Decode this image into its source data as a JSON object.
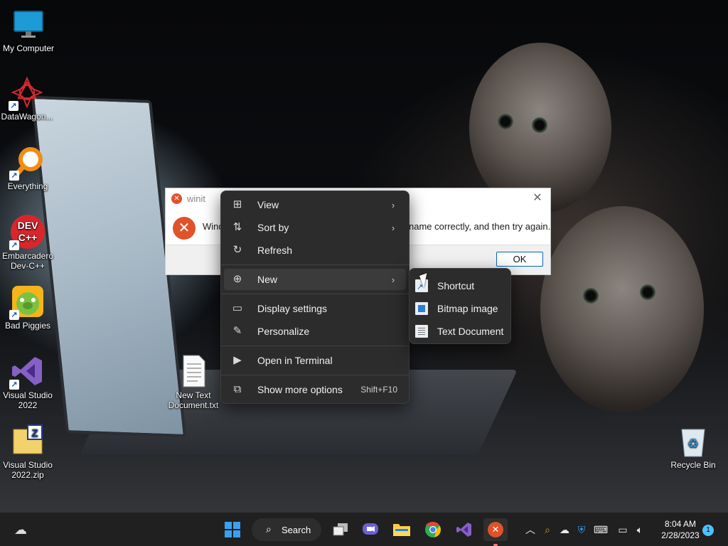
{
  "desktop": {
    "icons": [
      {
        "label": "My Computer"
      },
      {
        "label": "DataWagon..."
      },
      {
        "label": "Everything"
      },
      {
        "label": "Embarcadero Dev-C++"
      },
      {
        "label": "Bad Piggies"
      },
      {
        "label": "Visual Studio 2022"
      },
      {
        "label": "Visual Studio 2022.zip"
      },
      {
        "label": "New Text Document.txt"
      },
      {
        "label": "Recycle Bin"
      }
    ],
    "devcpp_logo_text": "DEV C++"
  },
  "dialog": {
    "title": "winit",
    "message_left": "Windo",
    "message_right": "name correctly, and then try again.",
    "ok_label": "OK"
  },
  "context_menu": {
    "items": [
      {
        "label": "View",
        "icon": "view-grid-icon"
      },
      {
        "label": "Sort by",
        "icon": "sort-icon"
      },
      {
        "label": "Refresh",
        "icon": "refresh-icon"
      },
      {
        "label": "New",
        "icon": "new-plus-icon"
      },
      {
        "label": "Display settings",
        "icon": "display-icon"
      },
      {
        "label": "Personalize",
        "icon": "brush-icon"
      },
      {
        "label": "Open in Terminal",
        "icon": "terminal-icon"
      },
      {
        "label": "Show more options",
        "icon": "more-options-icon",
        "shortcut": "Shift+F10"
      }
    ],
    "submenu": {
      "items": [
        {
          "label": "Shortcut",
          "icon": "shortcut-icon"
        },
        {
          "label": "Bitmap image",
          "icon": "bitmap-icon"
        },
        {
          "label": "Text Document",
          "icon": "text-document-icon"
        }
      ]
    }
  },
  "taskbar": {
    "search_label": "Search",
    "clock_time": "8:04 AM",
    "clock_date": "2/28/2023",
    "notification_count": "1",
    "accent": "#e0522a"
  }
}
